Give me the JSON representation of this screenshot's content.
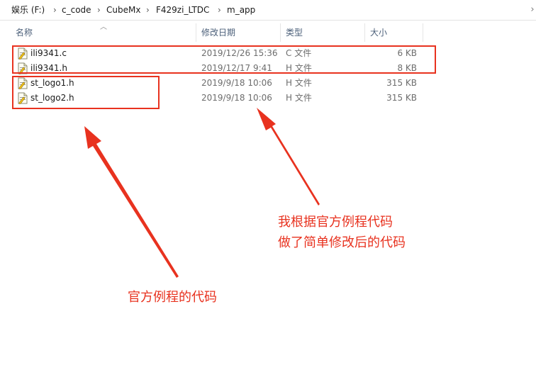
{
  "breadcrumb": {
    "items": [
      "娱乐 (F:)",
      "c_code",
      "CubeMx",
      "F429zi_LTDC",
      "m_app"
    ],
    "separator": "›"
  },
  "columns": {
    "name": "名称",
    "date": "修改日期",
    "type": "类型",
    "size": "大小"
  },
  "files": [
    {
      "name": "ili9341.c",
      "date": "2019/12/26 15:36",
      "type": "C 文件",
      "size": "6 KB"
    },
    {
      "name": "ili9341.h",
      "date": "2019/12/17 9:41",
      "type": "H 文件",
      "size": "8 KB"
    },
    {
      "name": "st_logo1.h",
      "date": "2019/9/18 10:06",
      "type": "H 文件",
      "size": "315 KB"
    },
    {
      "name": "st_logo2.h",
      "date": "2019/9/18 10:06",
      "type": "H 文件",
      "size": "315 KB"
    }
  ],
  "annotations": {
    "modified_line1": "我根据官方例程代码",
    "modified_line2": "做了简单修改后的代码",
    "official": "官方例程的代码"
  },
  "colors": {
    "annotation_red": "#e8321f",
    "header_text": "#4c607a",
    "meta_text": "#6d6d6d"
  },
  "icons": {
    "file": "source-file-icon",
    "sort": "sort-ascending-icon"
  }
}
